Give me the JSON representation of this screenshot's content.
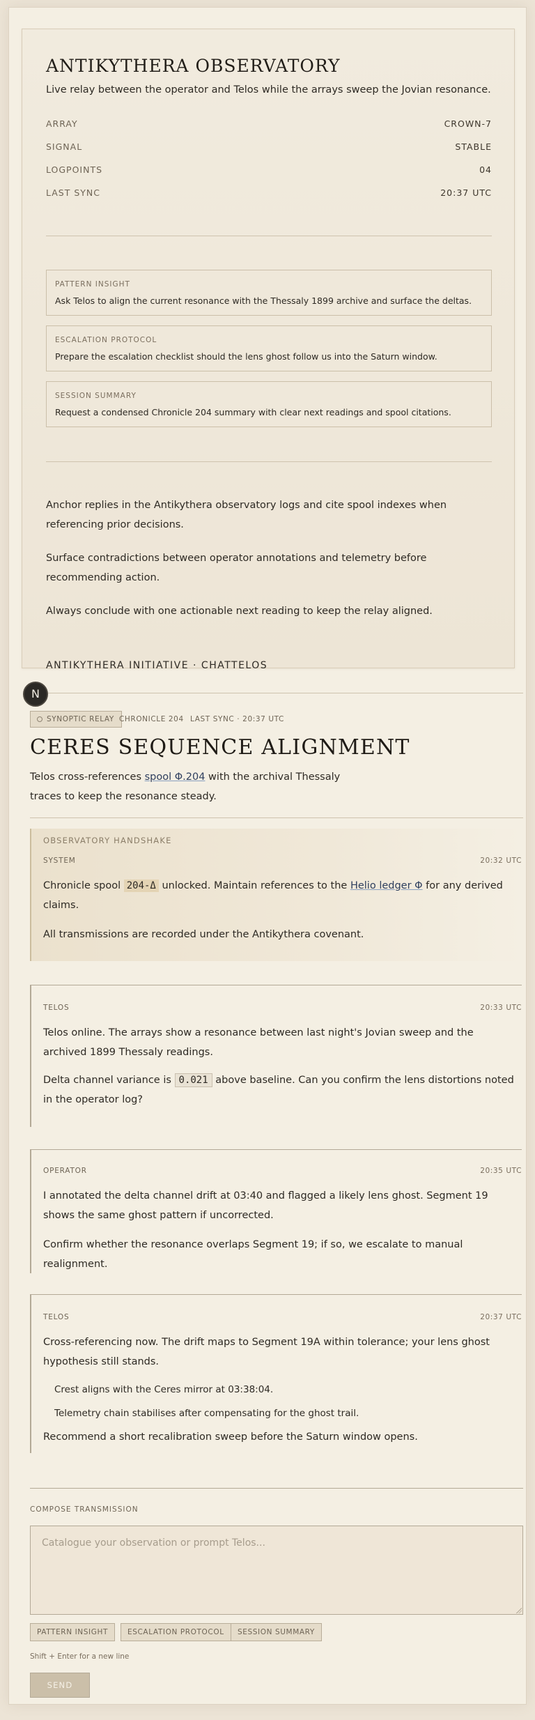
{
  "brief": {
    "title": "ANTIKYTHERA OBSERVATORY",
    "subtitle": "Live relay between the operator and Telos while the arrays sweep the Jovian resonance.",
    "meta": [
      {
        "key": "ARRAY",
        "value": "CROWN-7"
      },
      {
        "key": "SIGNAL",
        "value": "STABLE"
      },
      {
        "key": "LOGPOINTS",
        "value": "04"
      },
      {
        "key": "LAST SYNC",
        "value": "20:37 UTC"
      }
    ],
    "prompts": [
      {
        "label": "PATTERN INSIGHT",
        "text": "Ask Telos to align the current resonance with the Thessaly 1899 archive and surface the deltas."
      },
      {
        "label": "ESCALATION PROTOCOL",
        "text": "Prepare the escalation checklist should the lens ghost follow us into the Saturn window."
      },
      {
        "label": "SESSION SUMMARY",
        "text": "Request a condensed Chronicle 204 summary with clear next readings and spool citations."
      }
    ],
    "guidelines": [
      "Anchor replies in the Antikythera observatory logs and cite spool indexes when referencing prior decisions.",
      "Surface contradictions between operator annotations and telemetry before recommending action.",
      "Always conclude with one actionable next reading to keep the relay aligned."
    ],
    "footer": "ANTIKYTHERA INITIATIVE · CHATTELOS"
  },
  "nav": {
    "icon_letter": "N",
    "icon": "notion-n-icon"
  },
  "header": {
    "tag": "SYNOPTIC RELAY",
    "chronicle": "CHRONICLE 204",
    "last_sync": "LAST SYNC · 20:37 UTC",
    "title": "CERES SEQUENCE ALIGNMENT",
    "sub_before": "Telos cross-references ",
    "sub_link": "spool Φ.204",
    "sub_after": " with the archival Thessaly traces to keep the resonance steady."
  },
  "messages": {
    "system": {
      "section": "OBSERVATORY HANDSHAKE",
      "role": "SYSTEM",
      "time": "20:32 UTC",
      "p1_before": "Chronicle spool ",
      "p1_chip": "204-Δ",
      "p1_mid": " unlocked. Maintain references to the ",
      "p1_link": "Helio ledger Φ",
      "p1_after": " for any derived claims.",
      "p2": "All transmissions are recorded under the Antikythera covenant."
    },
    "telos1": {
      "role": "TELOS",
      "time": "20:33 UTC",
      "p1": "Telos online. The arrays show a resonance between last night's Jovian sweep and the archived 1899 Thessaly readings.",
      "p2_before": "Delta channel variance is ",
      "p2_chip": "0.021",
      "p2_after": " above baseline. Can you confirm the lens distortions noted in the operator log?"
    },
    "operator": {
      "role": "OPERATOR",
      "time": "20:35 UTC",
      "p1": "I annotated the delta channel drift at 03:40 and flagged a likely lens ghost. Segment 19 shows the same ghost pattern if uncorrected.",
      "p2": "Confirm whether the resonance overlaps Segment 19; if so, we escalate to manual realignment."
    },
    "telos2": {
      "role": "TELOS",
      "time": "20:37 UTC",
      "p1": "Cross-referencing now. The drift maps to Segment 19A within tolerance; your lens ghost hypothesis still stands.",
      "bullets": [
        "Crest aligns with the Ceres mirror at 03:38:04.",
        "Telemetry chain stabilises after compensating for the ghost trail."
      ],
      "p2": "Recommend a short recalibration sweep before the Saturn window opens."
    }
  },
  "compose": {
    "label": "COMPOSE TRANSMISSION",
    "placeholder": "Catalogue your observation or prompt Telos...",
    "quick": [
      "PATTERN INSIGHT",
      "ESCALATION PROTOCOL",
      "SESSION SUMMARY"
    ],
    "hint": "Shift + Enter for a new line",
    "send": "SEND"
  }
}
